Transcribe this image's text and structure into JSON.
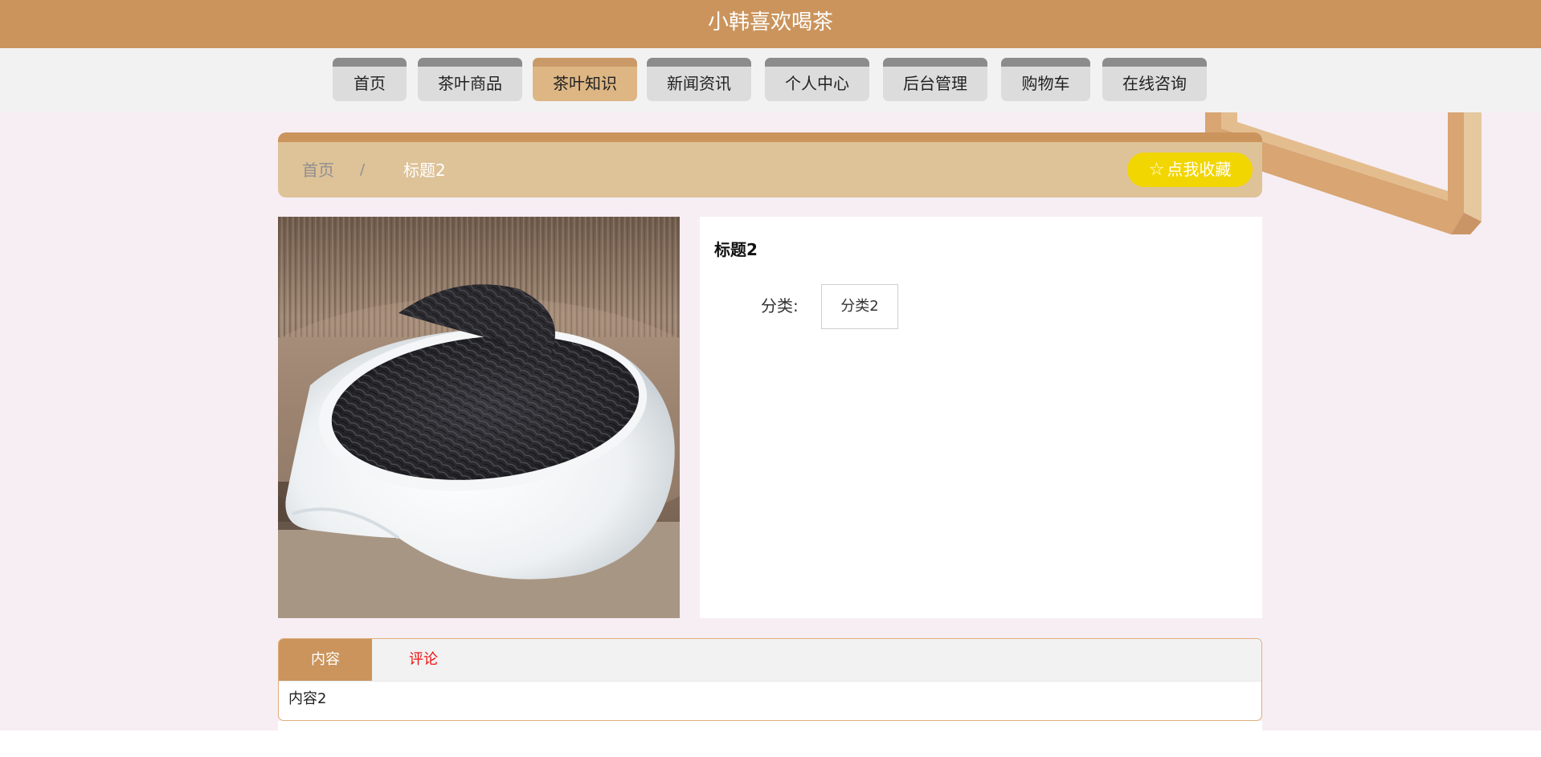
{
  "header": {
    "site_title": "小韩喜欢喝茶"
  },
  "nav": {
    "items": [
      {
        "label": "首页"
      },
      {
        "label": "茶叶商品"
      },
      {
        "label": "茶叶知识"
      },
      {
        "label": "新闻资讯"
      },
      {
        "label": "个人中心"
      },
      {
        "label": "后台管理"
      },
      {
        "label": "购物车"
      },
      {
        "label": "在线咨询"
      }
    ],
    "active_index": 2
  },
  "breadcrumb": {
    "home": "首页",
    "separator": "/",
    "current": "标题2"
  },
  "favorite": {
    "label": "点我收藏",
    "icon": "star-outline-icon"
  },
  "detail": {
    "title": "标题2",
    "category_label": "分类:",
    "category_value": "分类2"
  },
  "tabs": {
    "items": [
      {
        "label": "内容"
      },
      {
        "label": "评论"
      }
    ],
    "active_index": 0,
    "content": "内容2"
  },
  "colors": {
    "primary": "#ca945c",
    "primary_light": "#dec298",
    "favorite_yellow": "#f2d602",
    "page_bg": "#f6eef3",
    "comment_red": "#ee1111"
  }
}
